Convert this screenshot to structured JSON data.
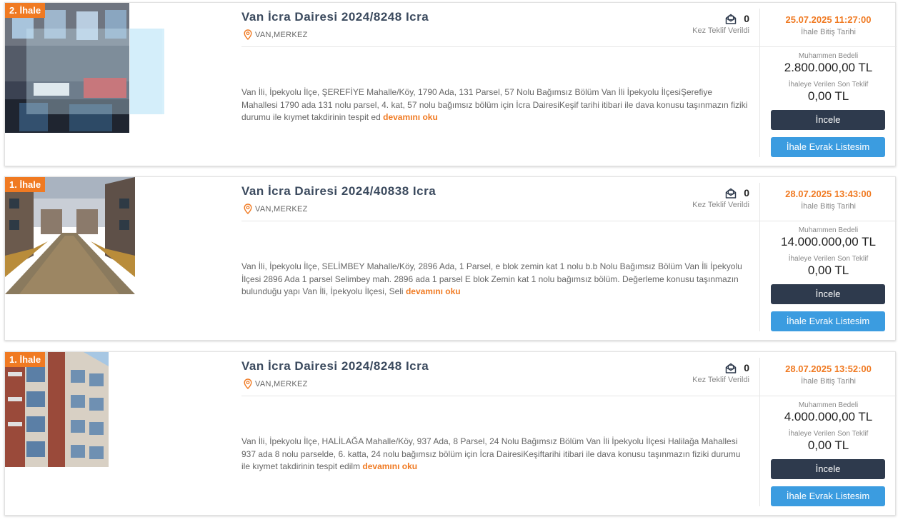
{
  "accent_color": "#f07a22",
  "dark_button_color": "#2e3a4d",
  "blue_button_color": "#3b9ce0",
  "listings": [
    {
      "badge": "2. İhale",
      "title": "Van İcra Dairesi 2024/8248 Icra",
      "location": "VAN,MERKEZ",
      "offer_count": "0",
      "offer_label": "Kez Teklif Verildi",
      "description": "Van İli, İpekyolu İlçe, ŞEREFİYE Mahalle/Köy, 1790 Ada, 131 Parsel, 57 Nolu Bağımsız Bölüm Van İli İpekyolu İlçesiŞerefiye Mahallesi 1790 ada 131 nolu parsel, 4. kat, 57 nolu bağımsız bölüm için İcra DairesiKeşif tarihi itibari ile dava konusu taşınmazın fiziki durumu ile kıymet takdirinin tespit ed",
      "read_more": "devamını oku",
      "end_date": "25.07.2025 11:27:00",
      "end_date_label": "İhale Bitiş Tarihi",
      "estimated_label": "Muhammen Bedeli",
      "estimated_value": "2.800.000,00 TL",
      "last_offer_label": "İhaleye Verilen Son Teklif",
      "last_offer_value": "0,00 TL",
      "inspect_label": "İncele",
      "docs_label": "İhale Evrak Listesim"
    },
    {
      "badge": "1. İhale",
      "title": "Van İcra Dairesi 2024/40838 Icra",
      "location": "VAN,MERKEZ",
      "offer_count": "0",
      "offer_label": "Kez Teklif Verildi",
      "description": "Van İli, İpekyolu İlçe, SELİMBEY Mahalle/Köy, 2896 Ada, 1 Parsel, e blok zemin kat 1 nolu b.b Nolu Bağımsız Bölüm Van İli İpekyolu İlçesi 2896 Ada 1 parsel Selimbey mah. 2896 ada 1 parsel E blok Zemin kat 1 nolu bağımsız bölüm. Değerleme konusu taşınmazın bulunduğu yapı Van İli, İpekyolu İlçesi, Seli",
      "read_more": "devamını oku",
      "end_date": "28.07.2025 13:43:00",
      "end_date_label": "İhale Bitiş Tarihi",
      "estimated_label": "Muhammen Bedeli",
      "estimated_value": "14.000.000,00 TL",
      "last_offer_label": "İhaleye Verilen Son Teklif",
      "last_offer_value": "0,00 TL",
      "inspect_label": "İncele",
      "docs_label": "İhale Evrak Listesim"
    },
    {
      "badge": "1. İhale",
      "title": "Van İcra Dairesi 2024/8248 Icra",
      "location": "VAN,MERKEZ",
      "offer_count": "0",
      "offer_label": "Kez Teklif Verildi",
      "description": "Van İli, İpekyolu İlçe, HALİLAĞA Mahalle/Köy, 937 Ada, 8 Parsel, 24 Nolu Bağımsız Bölüm Van İli İpekyolu İlçesi Halilağa Mahallesi 937 ada 8 nolu parselde, 6. katta, 24 nolu bağımsız bölüm için İcra DairesiKeşiftarihi itibari ile dava konusu taşınmazın fiziki durumu ile kıymet takdirinin tespit edilm",
      "read_more": "devamını oku",
      "end_date": "28.07.2025 13:52:00",
      "end_date_label": "İhale Bitiş Tarihi",
      "estimated_label": "Muhammen Bedeli",
      "estimated_value": "4.000.000,00 TL",
      "last_offer_label": "İhaleye Verilen Son Teklif",
      "last_offer_value": "0,00 TL",
      "inspect_label": "İncele",
      "docs_label": "İhale Evrak Listesim"
    }
  ]
}
